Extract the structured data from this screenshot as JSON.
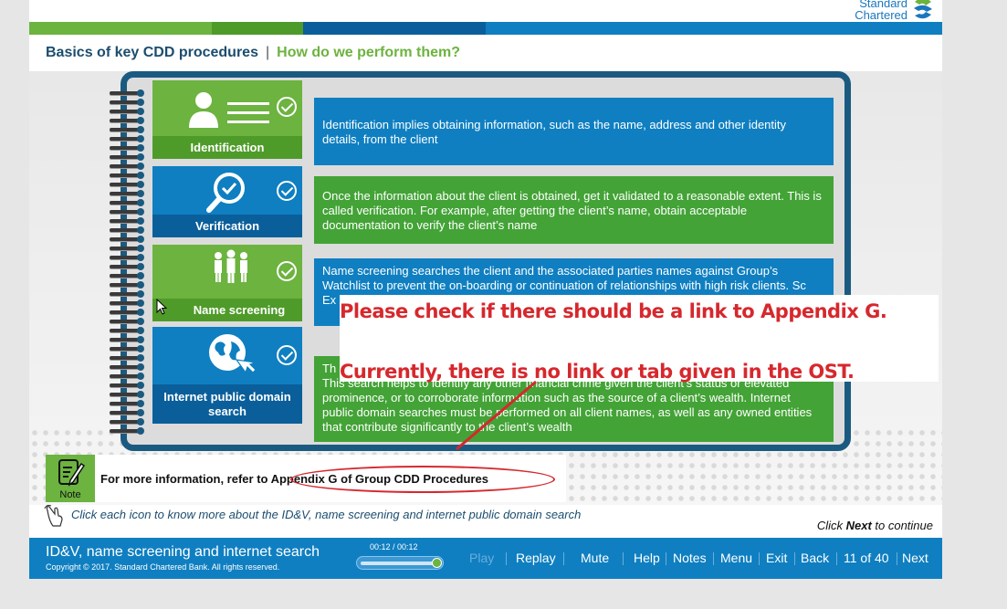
{
  "brand": {
    "name_line1": "Standard",
    "name_line2": "Chartered"
  },
  "header": {
    "title": "Basics of key CDD procedures",
    "separator": "|",
    "subtitle": "How do we perform them?"
  },
  "steps": [
    {
      "label": "Identification",
      "icon": "id-card-icon",
      "text": "Identification implies obtaining information, such as the name, address and other identity details, from the client"
    },
    {
      "label": "Verification",
      "icon": "magnifier-check-icon",
      "text": "Once the information about the client is obtained, get it validated to a reasonable extent. This is called verification. For example, after getting the client’s name, obtain acceptable documentation to verify the client’s name"
    },
    {
      "label": "Name screening",
      "icon": "people-group-icon",
      "text": "Name screening searches the client and the associated parties names against Group’s Watchlist to prevent the on-boarding or continuation of relationships with high risk clients. Sc",
      "text_tail": "Ex"
    },
    {
      "label": "Internet public domain search",
      "icon": "globe-cursor-icon",
      "text_head": "Th",
      "text": "This search helps to identify any other financial crime given the client’s status or elevated prominence, or to corroborate information such as the source of a client’s wealth. Internet public domain searches must be performed on all client names, as well as any owned entities that contribute significantly to the client’s wealth"
    }
  ],
  "comment": {
    "line1": "Please check if there should be a link to Appendix G.",
    "line2": "Currently, there is no link or tab given in the OST."
  },
  "note": {
    "icon_label": "Note",
    "text_prefix": "For more information, refer to ",
    "link_text": "Appendix G of Group CDD Procedures"
  },
  "instruction": "Click each icon to know more about the ID&V, name screening and internet public domain search",
  "continue": {
    "prefix": "Click ",
    "bold": "Next",
    "suffix": " to continue"
  },
  "footer": {
    "title": "ID&V, name screening and internet search",
    "copyright": "Copyright © 2017. Standard Chartered Bank. All rights reserved.",
    "time": "00:12 / 00:12",
    "progress": 1.0,
    "buttons": {
      "play": "Play",
      "replay": "Replay",
      "mute": "Mute",
      "help": "Help",
      "notes": "Notes",
      "menu": "Menu",
      "exit": "Exit",
      "back": "Back",
      "page": "11 of 40",
      "next": "Next"
    }
  },
  "colors": {
    "blue": "#0f7fc1",
    "green": "#6cb33f",
    "dark_blue": "#1b5a80",
    "annotation_red": "#d6282d"
  }
}
